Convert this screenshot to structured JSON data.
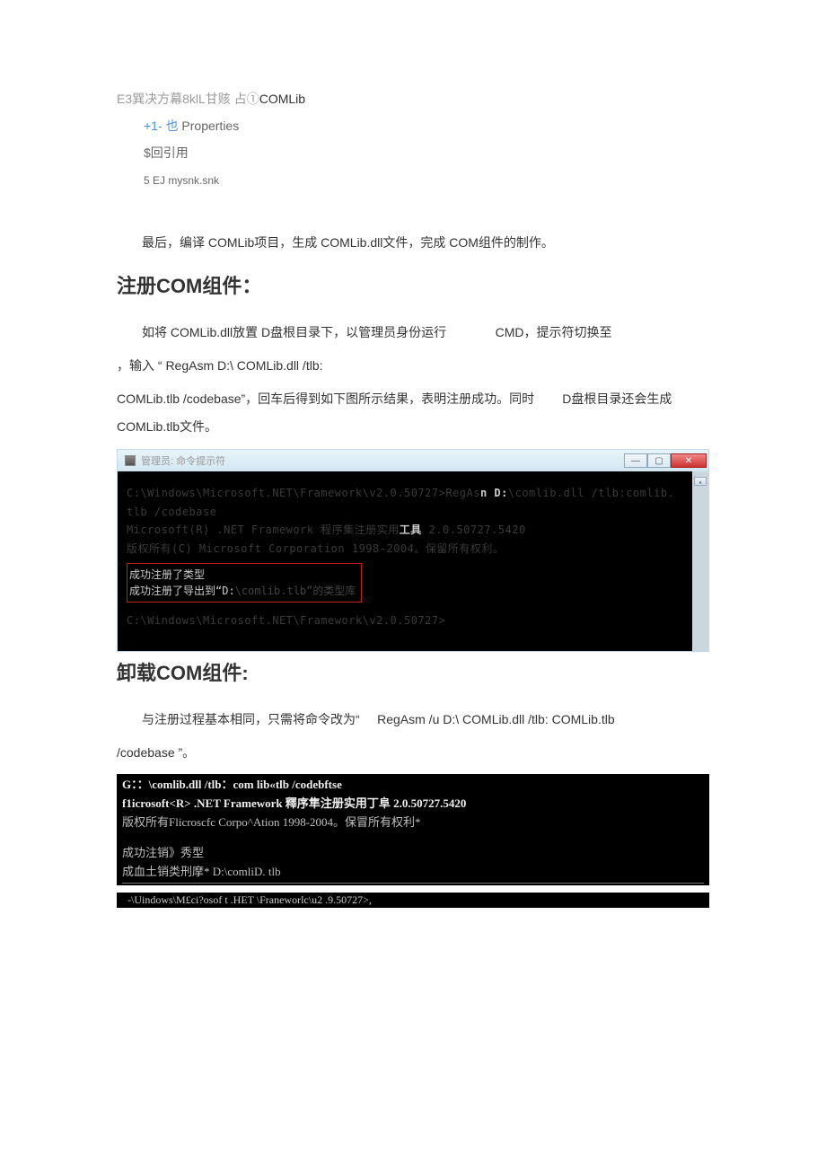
{
  "tree": {
    "line1_a": "E3巽决方幕8klL甘赅  占①",
    "line1_b": "COMLib",
    "line2_plus": "+1- 也",
    "line2_label": "  Properties",
    "line3": "$回引用",
    "line4": "5 EJ mysnk.snk"
  },
  "p1": "最后，编译 COMLib项目，生成 COMLib.dll文件，完成 COM组件的制作。",
  "h1": "注册COM组件：",
  "p2a": "如将 COMLib.dll放置 D盘根目录下，以管理员身份运行              CMD，提示符切换至",
  "p2b": "，输入 “ RegAsm D:\\ COMLib.dll /tlb:",
  "p2c": "COMLib.tlb /codebase”，回车后得到如下图所示结果，表明注册成功。同时        D盘根目录还会生成COMLib.tlb文件。",
  "cmd1": {
    "titlebar_text": "管理员: 命令提示符",
    "garble1a": "C:\\Windows\\Microsoft.NET\\Framework\\v2.0.50727>RegAs",
    "garble1b": "n D:",
    "garble1c": "\\comlib.dll /tlb:comlib.",
    "garble2": "tlb /codebase",
    "garble3": "Microsoft(R) .NET Framework 程序集注册实用",
    "garble3b": "工具",
    "garble3c": " 2.0.50727.5420",
    "garble4": "版权所有(C) Microsoft Corporation 1998-2004。保留所有权利。",
    "red1": "成功注册了类型",
    "red2a": "成功注册了导出到“D:",
    "red2b": "\\comlib.tlb”的类型库",
    "trail": "C:\\Windows\\Microsoft.NET\\Framework\\v2.0.50727>"
  },
  "h2": "卸载COM组件:",
  "p3a": "与注册过程基本相同，只需将命令改为“     RegAsm /u D:\\ COMLib.dll /tlb: COMLib.tlb",
  "p3b": "/codebase ”。",
  "cmd2": {
    "l1": " G：：\\comlib.dll /tlb：com lib«tlb /codebftse",
    "l2": "f1icrosoft<R> .NET Framework 釋序隼注册实用丁阜  2.0.50727.5420",
    "l3": "版权所有Flicroscfc Corpo^Ation 1998-2004。保冒所有权利*",
    "l4": "成功注销》秀型",
    "l5": "成血土销类刑摩*  D:\\comliD. tlb",
    "tail": "-\\Uindows\\M£ci?osof t .HET \\Franeworlc\\u2 .9.50727>,"
  }
}
